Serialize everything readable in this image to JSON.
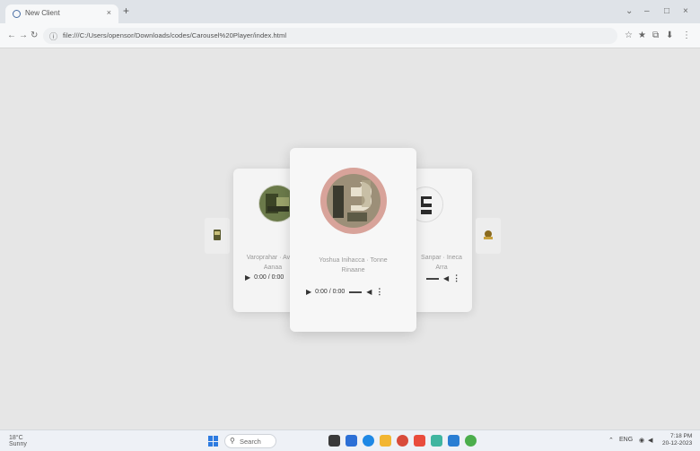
{
  "browser": {
    "tab_title": "New Client",
    "tab_close": "×",
    "new_tab": "+",
    "window_controls": [
      "⌄",
      "–",
      "□",
      "×"
    ],
    "nav": {
      "back": "←",
      "forward": "→",
      "reload": "↻"
    },
    "url": "file:///C:/Users/opensor/Downloads/codes/Carousel%20Player/index.html",
    "toolbar_icons": [
      "☆",
      "★",
      "⧉",
      "⬇",
      "⋮"
    ]
  },
  "carousel": {
    "center": {
      "title_line1": "Yoshua Inihacca · Tonne",
      "title_line2": "Rinaane",
      "time": "0:00 / 0:00",
      "play": "▶",
      "volume": "◀",
      "menu": "⋮"
    },
    "left": {
      "title_line1": "Varoprahar · Avaar",
      "title_line2": "Aanaa",
      "time": "0:00 / 0:00",
      "play": "▶"
    },
    "right": {
      "title_line1": "Sanpar · Ineca",
      "title_line2": "Arra",
      "volume": "◀",
      "menu": "⋮"
    }
  },
  "taskbar": {
    "weather_temp": "18°C",
    "weather_desc": "Sunny",
    "search_placeholder": "Search",
    "tray_text": "ENG",
    "time": "7:18 PM",
    "date": "20-12-2023"
  },
  "colors": {
    "accent": "#2d7be0",
    "disc_center_ring": "#d8a39a",
    "disc_left": "#6b7a4a"
  }
}
